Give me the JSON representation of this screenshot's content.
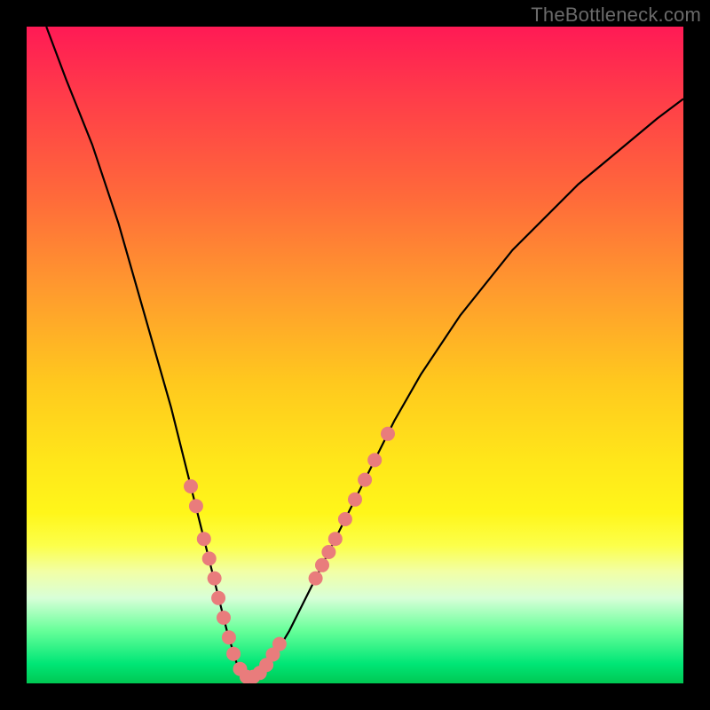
{
  "watermark": "TheBottleneck.com",
  "chart_data": {
    "type": "line",
    "title": "",
    "xlabel": "",
    "ylabel": "",
    "xlim": [
      0,
      100
    ],
    "ylim": [
      0,
      100
    ],
    "grid": false,
    "legend": false,
    "series": [
      {
        "name": "bottleneck-curve",
        "stroke": "#000000",
        "x": [
          3,
          6,
          10,
          14,
          18,
          22,
          25,
          27,
          29,
          30.5,
          32,
          33.5,
          35,
          37,
          40,
          44,
          48,
          52,
          56,
          60,
          66,
          74,
          84,
          96,
          100
        ],
        "y": [
          100,
          92,
          82,
          70,
          56,
          42,
          30,
          22,
          14,
          8,
          3,
          1,
          1,
          3,
          8,
          16,
          24,
          32,
          40,
          47,
          56,
          66,
          76,
          86,
          89
        ]
      }
    ],
    "markers": {
      "name": "highlighted-points",
      "color": "#e97c7c",
      "radius_px": 8,
      "points": [
        {
          "x": 25.0,
          "y": 30
        },
        {
          "x": 25.8,
          "y": 27
        },
        {
          "x": 27.0,
          "y": 22
        },
        {
          "x": 27.8,
          "y": 19
        },
        {
          "x": 28.6,
          "y": 16
        },
        {
          "x": 29.2,
          "y": 13
        },
        {
          "x": 30.0,
          "y": 10
        },
        {
          "x": 30.8,
          "y": 7
        },
        {
          "x": 31.5,
          "y": 4.5
        },
        {
          "x": 32.5,
          "y": 2.2
        },
        {
          "x": 33.5,
          "y": 1.0
        },
        {
          "x": 34.5,
          "y": 1.0
        },
        {
          "x": 35.5,
          "y": 1.6
        },
        {
          "x": 36.5,
          "y": 2.8
        },
        {
          "x": 37.5,
          "y": 4.4
        },
        {
          "x": 38.5,
          "y": 6.0
        },
        {
          "x": 44.0,
          "y": 16
        },
        {
          "x": 45.0,
          "y": 18
        },
        {
          "x": 46.0,
          "y": 20
        },
        {
          "x": 47.0,
          "y": 22
        },
        {
          "x": 48.5,
          "y": 25
        },
        {
          "x": 50.0,
          "y": 28
        },
        {
          "x": 51.5,
          "y": 31
        },
        {
          "x": 53.0,
          "y": 34
        },
        {
          "x": 55.0,
          "y": 38
        }
      ]
    }
  }
}
